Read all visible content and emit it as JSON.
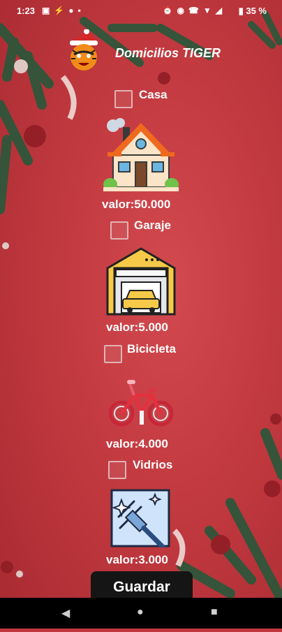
{
  "status_bar": {
    "time": "1:23",
    "battery": "35 %",
    "icons_left": [
      "photo-icon",
      "run-icon",
      "circle-icon",
      "dot-icon"
    ],
    "icons_right": [
      "alarm-icon",
      "vibrate-icon",
      "wifi-calling-icon",
      "wifi-icon",
      "signal-icon",
      "battery-icon"
    ]
  },
  "header": {
    "title": "Domicilios TIGER",
    "logo": "tiger-santa-logo"
  },
  "items": [
    {
      "label": "Casa",
      "value": "valor:50.000",
      "icon": "house-icon",
      "checked": false
    },
    {
      "label": "Garaje",
      "value": "valor:5.000",
      "icon": "garage-icon",
      "checked": false
    },
    {
      "label": "Bicicleta",
      "value": "valor:4.000",
      "icon": "bicycle-icon",
      "checked": false
    },
    {
      "label": "Vidrios",
      "value": "valor:3.000",
      "icon": "window-cleaning-icon",
      "checked": false
    }
  ],
  "actions": {
    "save_label": "Guardar"
  },
  "nav": {
    "icons": [
      "back-icon",
      "home-icon",
      "recents-icon"
    ]
  },
  "colors": {
    "background": "#c2373d",
    "button": "#151515",
    "text": "#ffffff"
  }
}
